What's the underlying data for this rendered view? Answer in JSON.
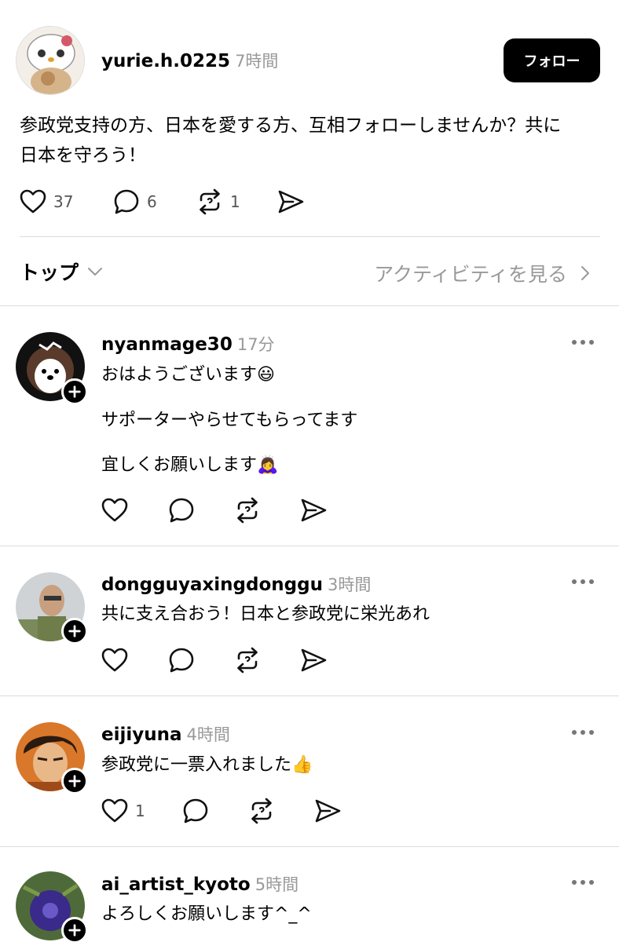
{
  "post": {
    "username": "yurie.h.0225",
    "time": "7時間",
    "follow_label": "フォロー",
    "text_line1": "参政党支持の方、日本を愛する方、互相フォローしませんか？共に",
    "text_line2": "日本を守ろう！",
    "likes": "37",
    "comments": "6",
    "reposts": "1"
  },
  "sort": {
    "label": "トップ",
    "activity_label": "アクティビティを見る"
  },
  "replies": [
    {
      "username": "nyanmage30",
      "time": "17分",
      "lines": [
        "おはようございます😃",
        "サポーターやらせてもらってます",
        "宜しくお願いします🙇‍♀️"
      ]
    },
    {
      "username": "dongguyaxingdonggu",
      "time": "3時間",
      "lines": [
        "共に支え合おう！日本と参政党に栄光あれ"
      ]
    },
    {
      "username": "eijiyuna",
      "time": "4時間",
      "lines": [
        "参政党に一票入れました👍"
      ],
      "likes": "1"
    },
    {
      "username": "ai_artist_kyoto",
      "time": "5時間",
      "lines": [
        "よろしくお願いします^_^"
      ]
    }
  ],
  "icons": [
    "heart-icon",
    "comment-icon",
    "repost-icon",
    "share-icon",
    "more-icon",
    "plus-icon",
    "chevron-down-icon",
    "chevron-right-icon"
  ]
}
